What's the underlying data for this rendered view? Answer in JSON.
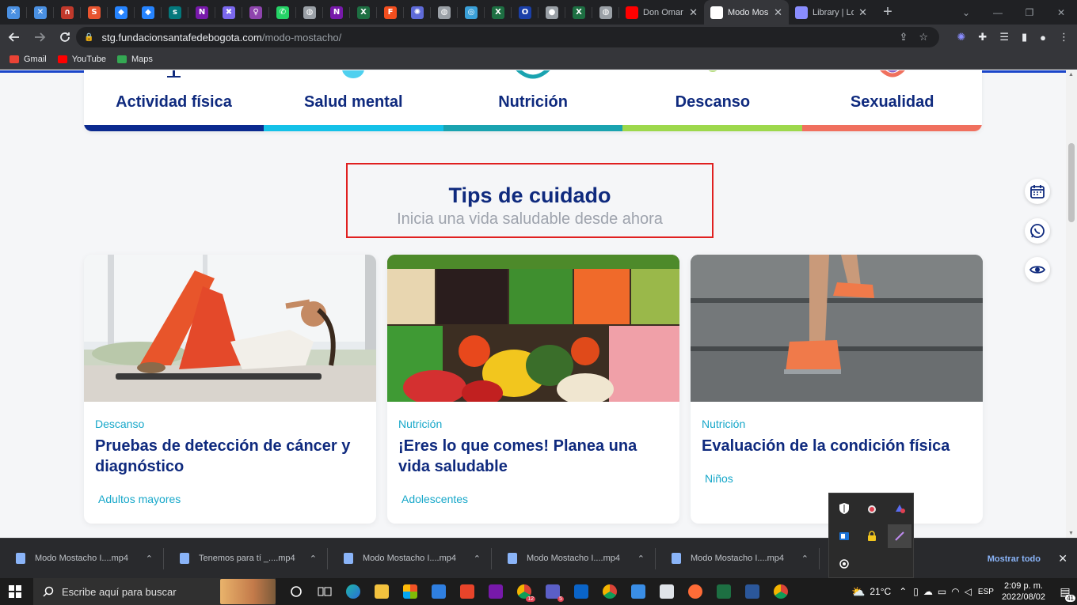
{
  "browser": {
    "mini_tabs": [
      {
        "icon": "x-logo-icon",
        "color": "#4a90e2",
        "glyph": "✕"
      },
      {
        "icon": "x-logo-icon",
        "color": "#4a90e2",
        "glyph": "✕"
      },
      {
        "icon": "headphones-icon",
        "color": "#c0392b",
        "glyph": "∩"
      },
      {
        "icon": "s-app-icon",
        "color": "#e8542f",
        "glyph": "S"
      },
      {
        "icon": "jira-icon",
        "color": "#2684ff",
        "glyph": "◆"
      },
      {
        "icon": "jira-icon",
        "color": "#2684ff",
        "glyph": "◆"
      },
      {
        "icon": "sharepoint-icon",
        "color": "#03787c",
        "glyph": "s"
      },
      {
        "icon": "onenote-icon",
        "color": "#7719aa",
        "glyph": "N"
      },
      {
        "icon": "clickup-icon",
        "color": "#7b68ee",
        "glyph": "✖"
      },
      {
        "icon": "figure-icon",
        "color": "#8e44ad",
        "glyph": "♀"
      },
      {
        "icon": "whatsapp-icon",
        "color": "#25d366",
        "glyph": "✆"
      },
      {
        "icon": "globe-icon",
        "color": "#9aa0a6",
        "glyph": "◍"
      },
      {
        "icon": "onenote-icon",
        "color": "#7719aa",
        "glyph": "N"
      },
      {
        "icon": "excel-icon",
        "color": "#1d6f42",
        "glyph": "X"
      },
      {
        "icon": "figma-icon",
        "color": "#f24e1e",
        "glyph": "F"
      },
      {
        "icon": "gear-icon",
        "color": "#5f6bd8",
        "glyph": "✺"
      },
      {
        "icon": "globe-icon",
        "color": "#9aa0a6",
        "glyph": "◍"
      },
      {
        "icon": "target-icon",
        "color": "#3aa0d8",
        "glyph": "◎"
      },
      {
        "icon": "excel-icon",
        "color": "#1d6f42",
        "glyph": "X"
      },
      {
        "icon": "circle-app-icon",
        "color": "#1a3fa8",
        "glyph": "O"
      },
      {
        "icon": "apple-icon",
        "color": "#9aa0a6",
        "glyph": "●"
      },
      {
        "icon": "excel-icon",
        "color": "#1d6f42",
        "glyph": "X"
      },
      {
        "icon": "globe-icon",
        "color": "#9aa0a6",
        "glyph": "◍"
      }
    ],
    "wide_tabs": [
      {
        "title": "Don Omar",
        "icon": "youtube-icon",
        "active": false
      },
      {
        "title": "Modo Mos",
        "icon": "snowflake-icon",
        "active": true
      },
      {
        "title": "Library | Lo",
        "icon": "gear-icon",
        "active": false
      }
    ],
    "url_host": "stg.fundacionsantafedebogota.com",
    "url_path": "/modo-mostacho/",
    "bookmarks": [
      {
        "label": "Gmail",
        "icon": "gmail-icon"
      },
      {
        "label": "YouTube",
        "icon": "youtube-icon"
      },
      {
        "label": "Maps",
        "icon": "maps-icon"
      }
    ]
  },
  "categories": [
    {
      "label": "Actividad física",
      "color": "#0b2a8f"
    },
    {
      "label": "Salud mental",
      "color": "#14c1e8"
    },
    {
      "label": "Nutrición",
      "color": "#1aa3b0"
    },
    {
      "label": "Descanso",
      "color": "#9dd84c"
    },
    {
      "label": "Sexualidad",
      "color": "#f0705e"
    }
  ],
  "tips": {
    "title": "Tips de cuidado",
    "subtitle": "Inicia una vida saludable desde ahora"
  },
  "cards": [
    {
      "category": "Descanso",
      "title": "Pruebas de detección de cáncer y diagnóstico",
      "audience": "Adultos mayores",
      "image": "woman-exercising-photo"
    },
    {
      "category": "Nutrición",
      "title": "¡Eres lo que comes! Planea una vida saludable",
      "audience": "Adolescentes",
      "image": "vegetables-photo"
    },
    {
      "category": "Nutrición",
      "title": "Evaluación de la condición física",
      "audience": "Niños",
      "image": "running-stairs-photo"
    }
  ],
  "floating_buttons": [
    "calendar-icon",
    "whatsapp-icon",
    "eye-icon"
  ],
  "downloads": [
    {
      "name": "Modo Mostacho I....mp4"
    },
    {
      "name": "Tenemos para tí _....mp4"
    },
    {
      "name": "Modo Mostacho I....mp4"
    },
    {
      "name": "Modo Mostacho I....mp4"
    },
    {
      "name": "Modo Mostacho I....mp4"
    }
  ],
  "downloads_show_all": "Mostrar todo",
  "taskbar": {
    "search_placeholder": "Escribe aquí para buscar",
    "weather": "21°C",
    "language": "ESP",
    "time": "2:09 p. m.",
    "date": "2022/08/02",
    "notification_count": "41",
    "badges": {
      "chrome_app": "12",
      "teams": "5"
    }
  }
}
